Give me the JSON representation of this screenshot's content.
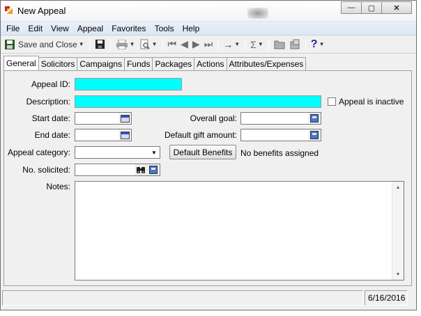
{
  "window": {
    "title": "New Appeal",
    "minimize": "—",
    "maximize": "▢",
    "close": "✕"
  },
  "menu": [
    "File",
    "Edit",
    "View",
    "Appeal",
    "Favorites",
    "Tools",
    "Help"
  ],
  "toolbar": {
    "save_close_label": "Save and Close"
  },
  "tabs": [
    "General",
    "Solicitors",
    "Campaigns",
    "Funds",
    "Packages",
    "Actions",
    "Attributes/Expenses"
  ],
  "form": {
    "appeal_id_label": "Appeal ID:",
    "appeal_id_value": "",
    "description_label": "Description:",
    "description_value": "",
    "inactive_label": "Appeal is inactive",
    "start_date_label": "Start date:",
    "end_date_label": "End date:",
    "overall_goal_label": "Overall goal:",
    "default_gift_label": "Default gift amount:",
    "category_label": "Appeal category:",
    "default_benefits_button": "Default Benefits",
    "benefits_status": "No benefits assigned",
    "solicited_label": "No. solicited:",
    "notes_label": "Notes:"
  },
  "status": {
    "date": "6/16/2016"
  },
  "colors": {
    "required_field": "#00ffff",
    "menubar": "#dde6f4"
  }
}
